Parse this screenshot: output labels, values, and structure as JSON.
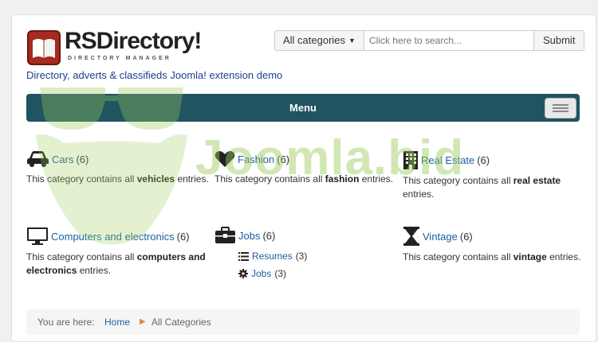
{
  "header": {
    "logo_text": "RSDirectory!",
    "logo_subtitle": "DIRECTORY MANAGER",
    "tagline": "Directory, adverts & classifieds Joomla! extension demo"
  },
  "search": {
    "category_label": "All categories",
    "placeholder": "Click here to search...",
    "submit_label": "Submit"
  },
  "menu": {
    "label": "Menu"
  },
  "categories": [
    {
      "name": "Cars",
      "count": "(6)",
      "desc_pre": "This category contains all ",
      "desc_bold": "vehicles",
      "desc_post": " entries.",
      "icon": "car-icon"
    },
    {
      "name": "Fashion",
      "count": "(6)",
      "desc_pre": "This category contains all ",
      "desc_bold": "fashion",
      "desc_post": " entries.",
      "icon": "heart-icon"
    },
    {
      "name": "Real Estate",
      "count": "(6)",
      "desc_pre": "This category contains all ",
      "desc_bold": "real estate",
      "desc_post": " entries.",
      "icon": "building-icon"
    },
    {
      "name": "Computers and electronics",
      "count": "(6)",
      "desc_pre": "This category contains all ",
      "desc_bold": "computers and electronics",
      "desc_post": " entries.",
      "icon": "monitor-icon"
    },
    {
      "name": "Jobs",
      "count": "(6)",
      "icon": "briefcase-icon",
      "subcategories": [
        {
          "name": "Resumes",
          "count": "(3)",
          "icon": "list-icon"
        },
        {
          "name": "Jobs",
          "count": "(3)",
          "icon": "cog-icon"
        }
      ]
    },
    {
      "name": "Vintage",
      "count": "(6)",
      "desc_pre": "This category contains all ",
      "desc_bold": "vintage",
      "desc_post": " entries.",
      "icon": "hourglass-icon"
    }
  ],
  "breadcrumb": {
    "prefix": "You are here:",
    "home": "Home",
    "current": "All Categories"
  },
  "watermark": {
    "text": "Joomla.bid"
  },
  "colors": {
    "link": "#1a5f9e",
    "menubar": "#1f5460",
    "logo_red": "#a52a1f",
    "watermark": "#9acb5a"
  }
}
